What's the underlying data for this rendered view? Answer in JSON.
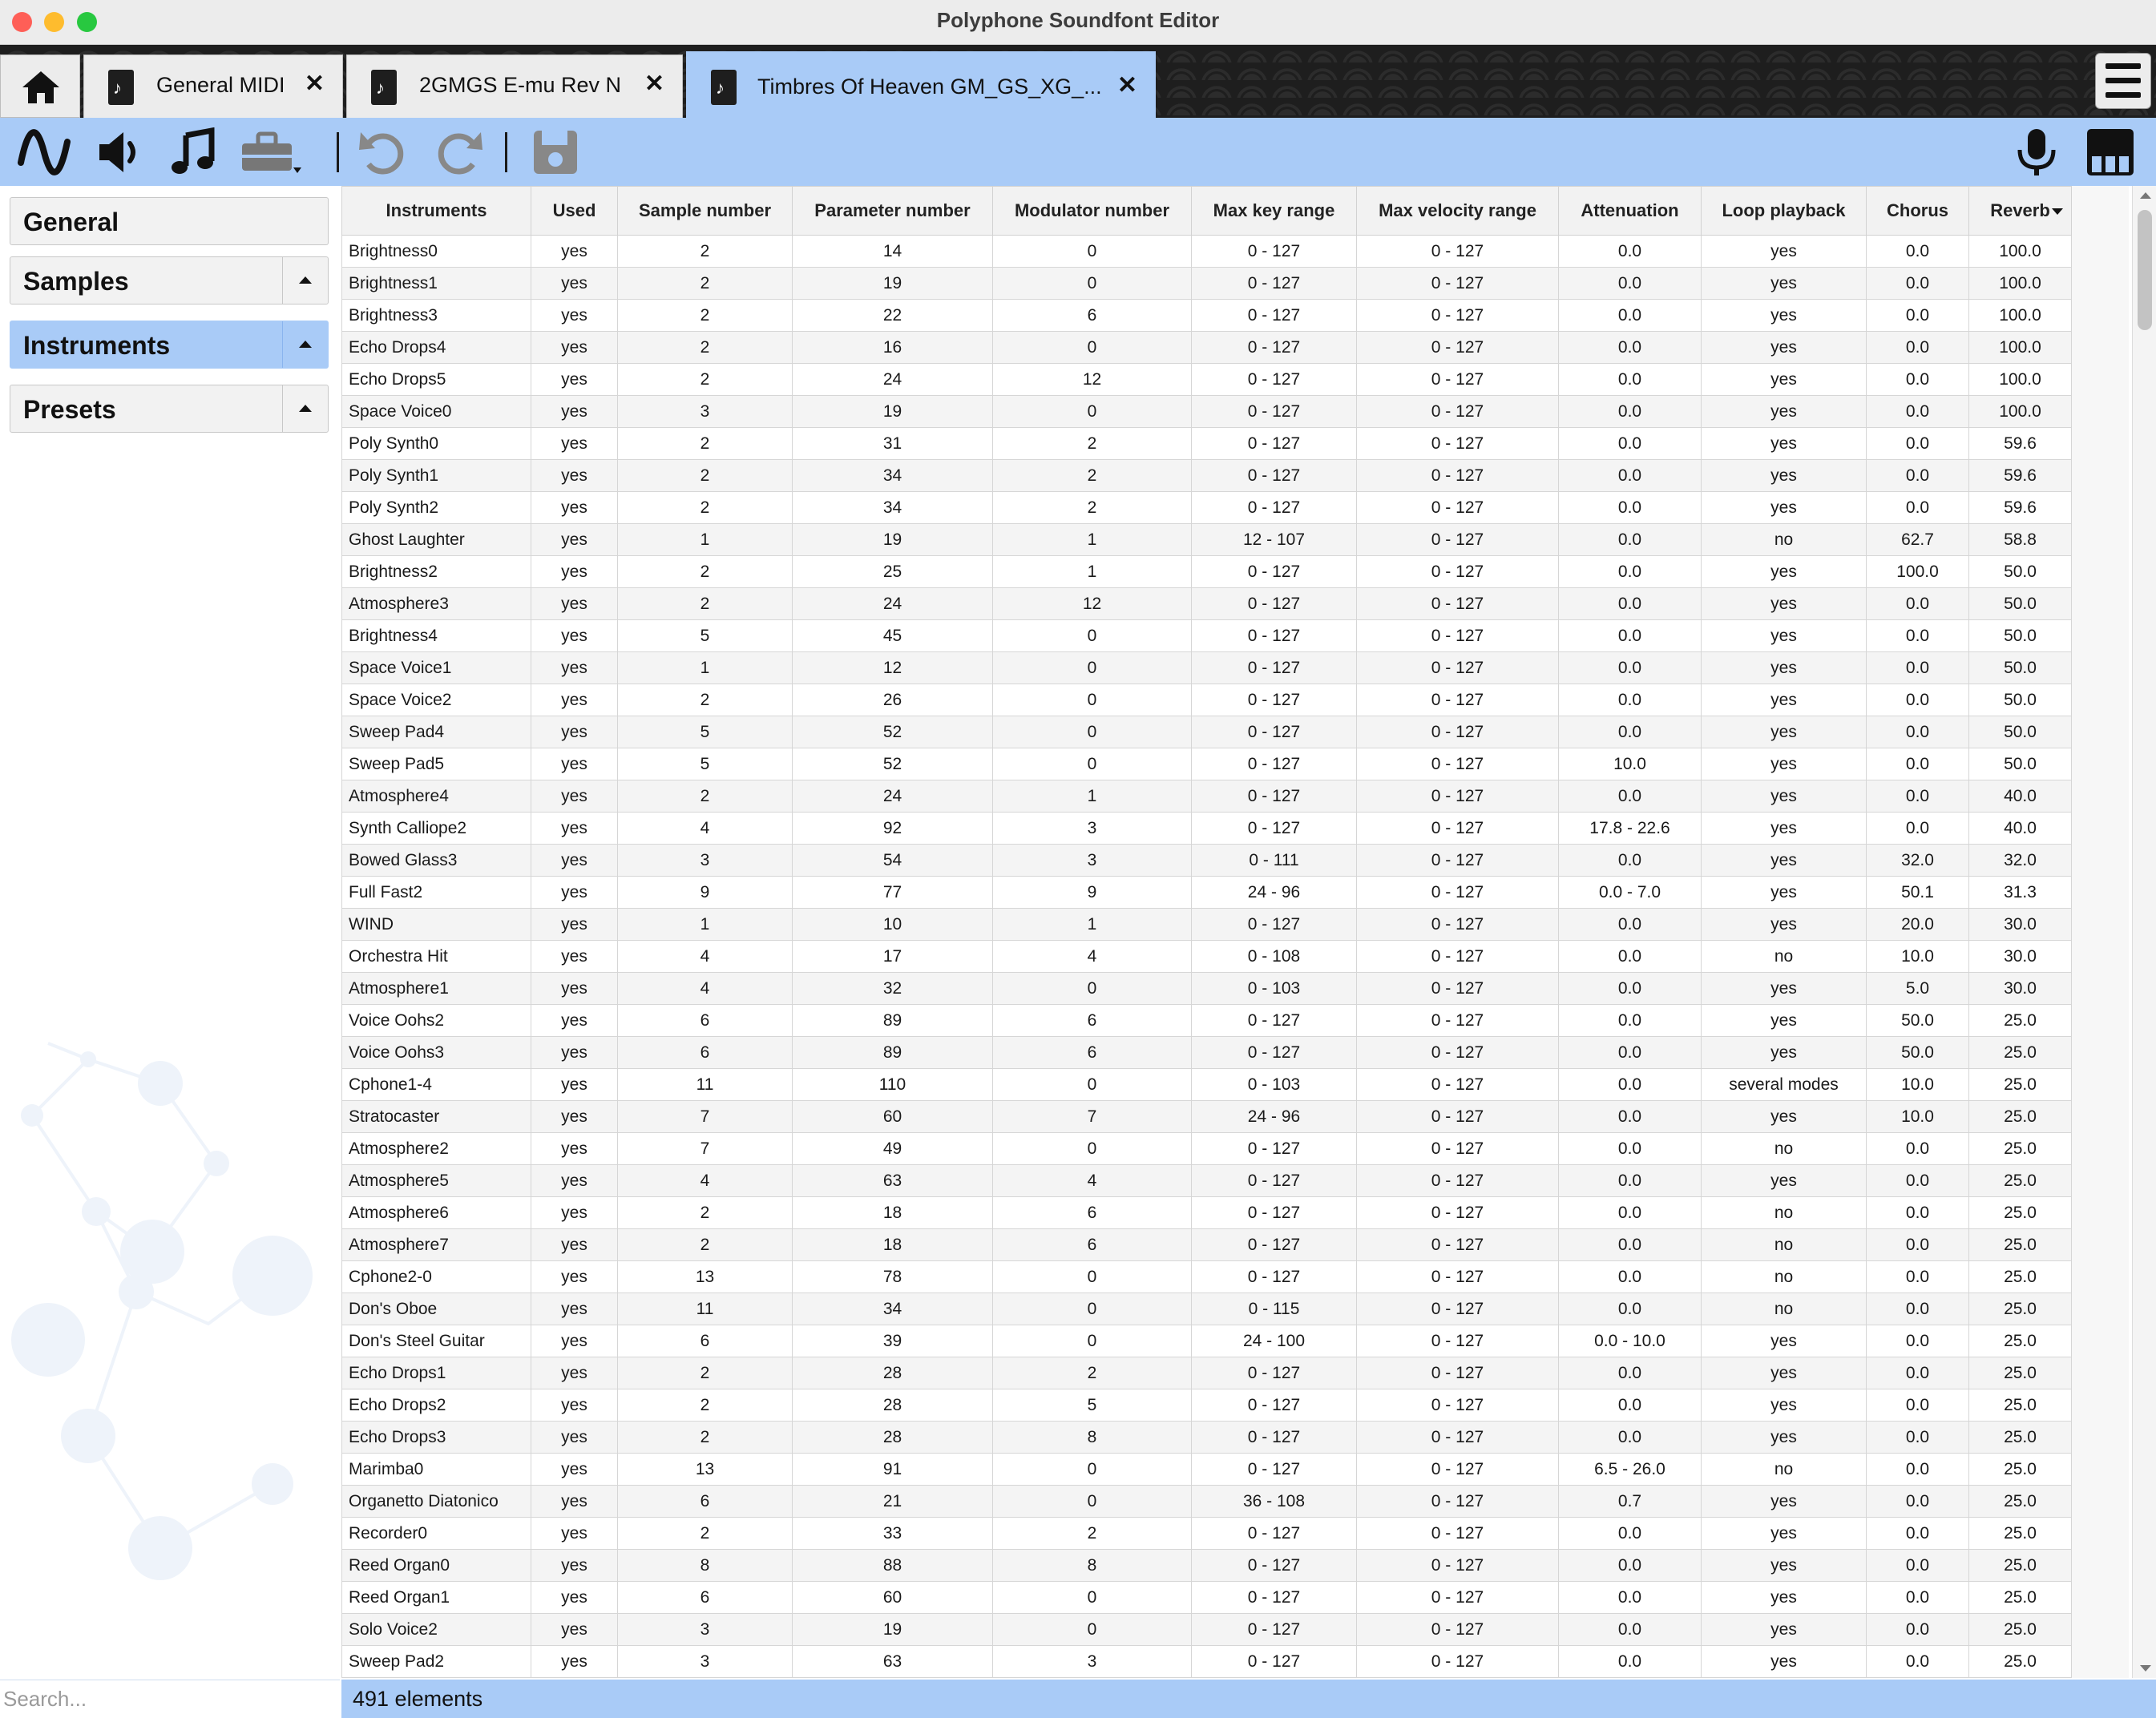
{
  "window": {
    "title": "Polyphone Soundfont Editor"
  },
  "tabs": [
    {
      "label": "General MIDI",
      "close": "✕"
    },
    {
      "label": "2GMGS E-mu  Rev N",
      "close": "✕"
    },
    {
      "label": "Timbres Of Heaven GM_GS_XG_...",
      "close": "✕"
    }
  ],
  "toolbar": {
    "left_icons": [
      "waveform-icon",
      "speaker-icon",
      "music-note-icon",
      "toolbox-icon",
      "undo-icon",
      "redo-icon",
      "save-icon"
    ],
    "right_icons": [
      "microphone-icon",
      "piano-icon"
    ]
  },
  "sidebar": {
    "items": [
      {
        "label": "General"
      },
      {
        "label": "Samples"
      },
      {
        "label": "Instruments"
      },
      {
        "label": "Presets"
      }
    ],
    "active": "Instruments"
  },
  "search": {
    "placeholder": "Search..."
  },
  "table": {
    "columns": [
      "Instruments",
      "Used",
      "Sample number",
      "Parameter number",
      "Modulator number",
      "Max key range",
      "Max velocity range",
      "Attenuation",
      "Loop playback",
      "Chorus",
      "Reverb"
    ],
    "sorted_by": "Reverb",
    "rows": [
      [
        "Brightness0",
        "yes",
        "2",
        "14",
        "0",
        "0 - 127",
        "0 - 127",
        "0.0",
        "yes",
        "0.0",
        "100.0"
      ],
      [
        "Brightness1",
        "yes",
        "2",
        "19",
        "0",
        "0 - 127",
        "0 - 127",
        "0.0",
        "yes",
        "0.0",
        "100.0"
      ],
      [
        "Brightness3",
        "yes",
        "2",
        "22",
        "6",
        "0 - 127",
        "0 - 127",
        "0.0",
        "yes",
        "0.0",
        "100.0"
      ],
      [
        "Echo Drops4",
        "yes",
        "2",
        "16",
        "0",
        "0 - 127",
        "0 - 127",
        "0.0",
        "yes",
        "0.0",
        "100.0"
      ],
      [
        "Echo Drops5",
        "yes",
        "2",
        "24",
        "12",
        "0 - 127",
        "0 - 127",
        "0.0",
        "yes",
        "0.0",
        "100.0"
      ],
      [
        "Space Voice0",
        "yes",
        "3",
        "19",
        "0",
        "0 - 127",
        "0 - 127",
        "0.0",
        "yes",
        "0.0",
        "100.0"
      ],
      [
        "Poly Synth0",
        "yes",
        "2",
        "31",
        "2",
        "0 - 127",
        "0 - 127",
        "0.0",
        "yes",
        "0.0",
        "59.6"
      ],
      [
        "Poly Synth1",
        "yes",
        "2",
        "34",
        "2",
        "0 - 127",
        "0 - 127",
        "0.0",
        "yes",
        "0.0",
        "59.6"
      ],
      [
        "Poly Synth2",
        "yes",
        "2",
        "34",
        "2",
        "0 - 127",
        "0 - 127",
        "0.0",
        "yes",
        "0.0",
        "59.6"
      ],
      [
        "Ghost Laughter",
        "yes",
        "1",
        "19",
        "1",
        "12 - 107",
        "0 - 127",
        "0.0",
        "no",
        "62.7",
        "58.8"
      ],
      [
        "Brightness2",
        "yes",
        "2",
        "25",
        "1",
        "0 - 127",
        "0 - 127",
        "0.0",
        "yes",
        "100.0",
        "50.0"
      ],
      [
        "Atmosphere3",
        "yes",
        "2",
        "24",
        "12",
        "0 - 127",
        "0 - 127",
        "0.0",
        "yes",
        "0.0",
        "50.0"
      ],
      [
        "Brightness4",
        "yes",
        "5",
        "45",
        "0",
        "0 - 127",
        "0 - 127",
        "0.0",
        "yes",
        "0.0",
        "50.0"
      ],
      [
        "Space Voice1",
        "yes",
        "1",
        "12",
        "0",
        "0 - 127",
        "0 - 127",
        "0.0",
        "yes",
        "0.0",
        "50.0"
      ],
      [
        "Space Voice2",
        "yes",
        "2",
        "26",
        "0",
        "0 - 127",
        "0 - 127",
        "0.0",
        "yes",
        "0.0",
        "50.0"
      ],
      [
        "Sweep Pad4",
        "yes",
        "5",
        "52",
        "0",
        "0 - 127",
        "0 - 127",
        "0.0",
        "yes",
        "0.0",
        "50.0"
      ],
      [
        "Sweep Pad5",
        "yes",
        "5",
        "52",
        "0",
        "0 - 127",
        "0 - 127",
        "10.0",
        "yes",
        "0.0",
        "50.0"
      ],
      [
        "Atmosphere4",
        "yes",
        "2",
        "24",
        "1",
        "0 - 127",
        "0 - 127",
        "0.0",
        "yes",
        "0.0",
        "40.0"
      ],
      [
        "Synth Calliope2",
        "yes",
        "4",
        "92",
        "3",
        "0 - 127",
        "0 - 127",
        "17.8 - 22.6",
        "yes",
        "0.0",
        "40.0"
      ],
      [
        "Bowed Glass3",
        "yes",
        "3",
        "54",
        "3",
        "0 - 111",
        "0 - 127",
        "0.0",
        "yes",
        "32.0",
        "32.0"
      ],
      [
        "Full Fast2",
        "yes",
        "9",
        "77",
        "9",
        "24 - 96",
        "0 - 127",
        "0.0 - 7.0",
        "yes",
        "50.1",
        "31.3"
      ],
      [
        "WIND",
        "yes",
        "1",
        "10",
        "1",
        "0 - 127",
        "0 - 127",
        "0.0",
        "yes",
        "20.0",
        "30.0"
      ],
      [
        "Orchestra Hit",
        "yes",
        "4",
        "17",
        "4",
        "0 - 108",
        "0 - 127",
        "0.0",
        "no",
        "10.0",
        "30.0"
      ],
      [
        "Atmosphere1",
        "yes",
        "4",
        "32",
        "0",
        "0 - 103",
        "0 - 127",
        "0.0",
        "yes",
        "5.0",
        "30.0"
      ],
      [
        "Voice Oohs2",
        "yes",
        "6",
        "89",
        "6",
        "0 - 127",
        "0 - 127",
        "0.0",
        "yes",
        "50.0",
        "25.0"
      ],
      [
        "Voice Oohs3",
        "yes",
        "6",
        "89",
        "6",
        "0 - 127",
        "0 - 127",
        "0.0",
        "yes",
        "50.0",
        "25.0"
      ],
      [
        "Cphone1-4",
        "yes",
        "11",
        "110",
        "0",
        "0 - 103",
        "0 - 127",
        "0.0",
        "several modes",
        "10.0",
        "25.0"
      ],
      [
        "Stratocaster",
        "yes",
        "7",
        "60",
        "7",
        "24 - 96",
        "0 - 127",
        "0.0",
        "yes",
        "10.0",
        "25.0"
      ],
      [
        "Atmosphere2",
        "yes",
        "7",
        "49",
        "0",
        "0 - 127",
        "0 - 127",
        "0.0",
        "no",
        "0.0",
        "25.0"
      ],
      [
        "Atmosphere5",
        "yes",
        "4",
        "63",
        "4",
        "0 - 127",
        "0 - 127",
        "0.0",
        "yes",
        "0.0",
        "25.0"
      ],
      [
        "Atmosphere6",
        "yes",
        "2",
        "18",
        "6",
        "0 - 127",
        "0 - 127",
        "0.0",
        "no",
        "0.0",
        "25.0"
      ],
      [
        "Atmosphere7",
        "yes",
        "2",
        "18",
        "6",
        "0 - 127",
        "0 - 127",
        "0.0",
        "no",
        "0.0",
        "25.0"
      ],
      [
        "Cphone2-0",
        "yes",
        "13",
        "78",
        "0",
        "0 - 127",
        "0 - 127",
        "0.0",
        "no",
        "0.0",
        "25.0"
      ],
      [
        "Don's Oboe",
        "yes",
        "11",
        "34",
        "0",
        "0 - 115",
        "0 - 127",
        "0.0",
        "no",
        "0.0",
        "25.0"
      ],
      [
        "Don's Steel Guitar",
        "yes",
        "6",
        "39",
        "0",
        "24 - 100",
        "0 - 127",
        "0.0 - 10.0",
        "yes",
        "0.0",
        "25.0"
      ],
      [
        "Echo Drops1",
        "yes",
        "2",
        "28",
        "2",
        "0 - 127",
        "0 - 127",
        "0.0",
        "yes",
        "0.0",
        "25.0"
      ],
      [
        "Echo Drops2",
        "yes",
        "2",
        "28",
        "5",
        "0 - 127",
        "0 - 127",
        "0.0",
        "yes",
        "0.0",
        "25.0"
      ],
      [
        "Echo Drops3",
        "yes",
        "2",
        "28",
        "8",
        "0 - 127",
        "0 - 127",
        "0.0",
        "yes",
        "0.0",
        "25.0"
      ],
      [
        "Marimba0",
        "yes",
        "13",
        "91",
        "0",
        "0 - 127",
        "0 - 127",
        "6.5 - 26.0",
        "no",
        "0.0",
        "25.0"
      ],
      [
        "Organetto Diatonico",
        "yes",
        "6",
        "21",
        "0",
        "36 - 108",
        "0 - 127",
        "0.7",
        "yes",
        "0.0",
        "25.0"
      ],
      [
        "Recorder0",
        "yes",
        "2",
        "33",
        "2",
        "0 - 127",
        "0 - 127",
        "0.0",
        "yes",
        "0.0",
        "25.0"
      ],
      [
        "Reed Organ0",
        "yes",
        "8",
        "88",
        "8",
        "0 - 127",
        "0 - 127",
        "0.0",
        "yes",
        "0.0",
        "25.0"
      ],
      [
        "Reed Organ1",
        "yes",
        "6",
        "60",
        "0",
        "0 - 127",
        "0 - 127",
        "0.0",
        "yes",
        "0.0",
        "25.0"
      ],
      [
        "Solo Voice2",
        "yes",
        "3",
        "19",
        "0",
        "0 - 127",
        "0 - 127",
        "0.0",
        "yes",
        "0.0",
        "25.0"
      ],
      [
        "Sweep Pad2",
        "yes",
        "3",
        "63",
        "3",
        "0 - 127",
        "0 - 127",
        "0.0",
        "yes",
        "0.0",
        "25.0"
      ]
    ]
  },
  "status": {
    "text": "491 elements"
  },
  "colors": {
    "accent": "#a9cbf7",
    "tabbar": "#1e1e1e",
    "header_bg": "#f2f2f2"
  }
}
